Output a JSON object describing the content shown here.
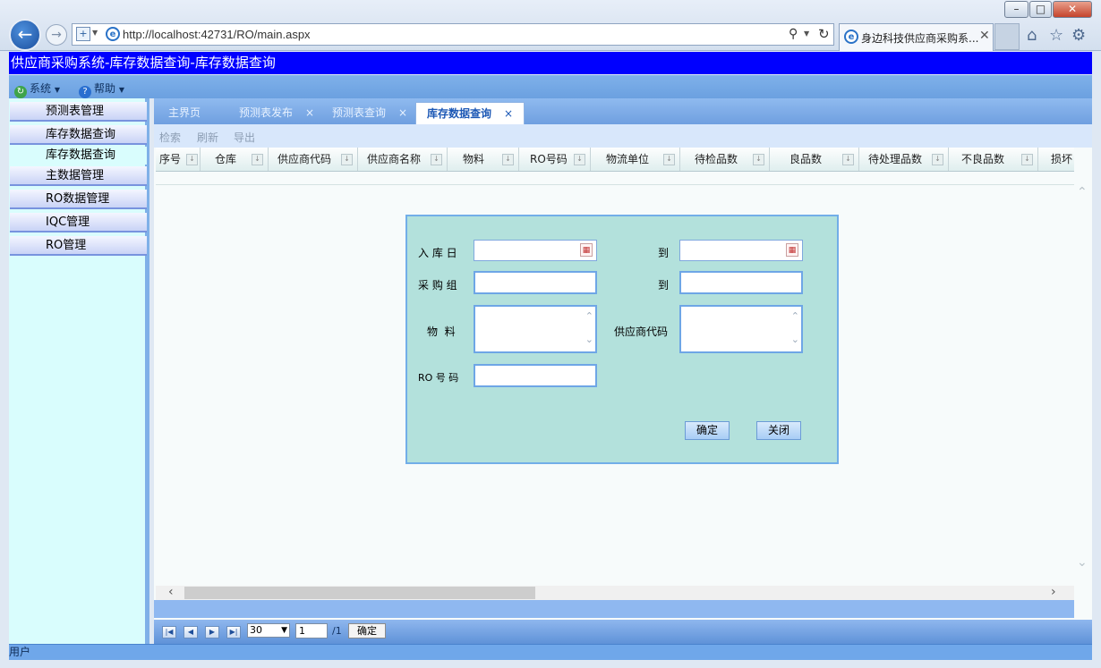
{
  "browser": {
    "url": "http://localhost:42731/RO/main.aspx",
    "url_host": "localhost",
    "tab_title": "身边科技供应商采购系...",
    "window_buttons": [
      "–",
      "□",
      "✕"
    ]
  },
  "app": {
    "title": "供应商采购系统-库存数据查询-库存数据查询"
  },
  "menu": {
    "system": "系统",
    "help": "帮助"
  },
  "sidebar": {
    "items": [
      {
        "label": "预测表管理"
      },
      {
        "label": "库存数据查询"
      },
      {
        "label": "库存数据查询"
      },
      {
        "label": "主数据管理"
      },
      {
        "label": "RO数据管理"
      },
      {
        "label": "IQC管理"
      },
      {
        "label": "RO管理"
      }
    ]
  },
  "tabs": [
    {
      "label": "主界页"
    },
    {
      "label": "预测表发布"
    },
    {
      "label": "预测表查询"
    },
    {
      "label": "库存数据查询",
      "active": true
    }
  ],
  "tab_close_glyph": "×",
  "toolbar": {
    "search": "检索",
    "refresh": "刷新",
    "export": "导出"
  },
  "grid": {
    "columns": [
      "序号",
      "仓库",
      "供应商代码",
      "供应商名称",
      "物料",
      "RO号码",
      "物流单位",
      "待检品数",
      "良品数",
      "待处理品数",
      "不良品数",
      "损坏"
    ]
  },
  "pager": {
    "page_size": "30",
    "page": "1",
    "of": "/1",
    "go": "确定"
  },
  "dialog": {
    "labels": {
      "date_in": "入 库 日",
      "to1": "到",
      "purchase_group": "采 购 组",
      "to2": "到",
      "material": "物  料",
      "supplier_code": "供应商代码",
      "ro_number": "RO 号 码"
    },
    "values": {
      "date_from": "",
      "date_to": "",
      "group_from": "",
      "group_to": "",
      "material": "",
      "supplier_code": "",
      "ro_number": ""
    },
    "ok": "确定",
    "close": "关闭"
  },
  "status_bar": {
    "user_label": "用户"
  },
  "colors": {
    "title_bar": "#0000ff",
    "dialog_bg": "#b3e1dc",
    "sidebar_bg": "#d9fdfd"
  }
}
